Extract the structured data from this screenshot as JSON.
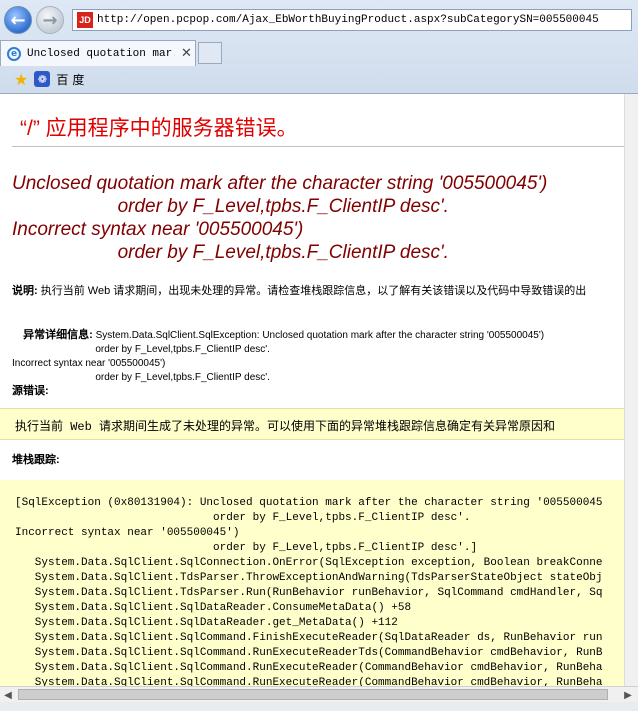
{
  "browser": {
    "url": "http://open.pcpop.com/Ajax_EbWorthBuyingProduct.aspx?subCategorySN=005500045",
    "site_icon_text": "JD",
    "tab_title": "Unclosed quotation mar...",
    "tab_close": "✕",
    "favorites_label": "百度"
  },
  "page": {
    "heading": "“/” 应用程序中的服务器错误。",
    "error_message": "Unclosed quotation mark after the character string '005500045')\n                    order by F_Level,tpbs.F_ClientIP desc'.\nIncorrect syntax near '005500045')\n                    order by F_Level,tpbs.F_ClientIP desc'.",
    "description_label": "说明:",
    "description_text": " 执行当前 Web 请求期间，出现未处理的异常。请检查堆栈跟踪信息，以了解有关该错误以及代码中导致错误的出",
    "details_label": "异常详细信息:",
    "details_text": " System.Data.SqlClient.SqlException: Unclosed quotation mark after the character string '005500045')\n                              order by F_Level,tpbs.F_ClientIP desc'.\nIncorrect syntax near '005500045')\n                              order by F_Level,tpbs.F_ClientIP desc'.",
    "source_label": "源错误:",
    "source_text": "执行当前 Web 请求期间生成了未处理的异常。可以使用下面的异常堆栈跟踪信息确定有关异常原因和",
    "stack_label": "堆栈跟踪:",
    "stack_trace": "[SqlException (0x80131904): Unclosed quotation mark after the character string '005500045\n                              order by F_Level,tpbs.F_ClientIP desc'.\nIncorrect syntax near '005500045')\n                              order by F_Level,tpbs.F_ClientIP desc'.]\n   System.Data.SqlClient.SqlConnection.OnError(SqlException exception, Boolean breakConne\n   System.Data.SqlClient.TdsParser.ThrowExceptionAndWarning(TdsParserStateObject stateObj\n   System.Data.SqlClient.TdsParser.Run(RunBehavior runBehavior, SqlCommand cmdHandler, Sq\n   System.Data.SqlClient.SqlDataReader.ConsumeMetaData() +58\n   System.Data.SqlClient.SqlDataReader.get_MetaData() +112\n   System.Data.SqlClient.SqlCommand.FinishExecuteReader(SqlDataReader ds, RunBehavior run\n   System.Data.SqlClient.SqlCommand.RunExecuteReaderTds(CommandBehavior cmdBehavior, RunB\n   System.Data.SqlClient.SqlCommand.RunExecuteReader(CommandBehavior cmdBehavior, RunBeha\n   System.Data.SqlClient.SqlCommand.RunExecuteReader(CommandBehavior cmdBehavior, RunBeha"
  },
  "colors": {
    "heading": "#e00000",
    "error_message": "#800000",
    "code_background": "#ffffcc"
  },
  "icons": {
    "back": "back-arrow-icon",
    "forward": "forward-arrow-icon",
    "tab": "ie-page-icon",
    "favorites": "favorites-star-icon",
    "baidu": "baidu-paw-icon"
  }
}
